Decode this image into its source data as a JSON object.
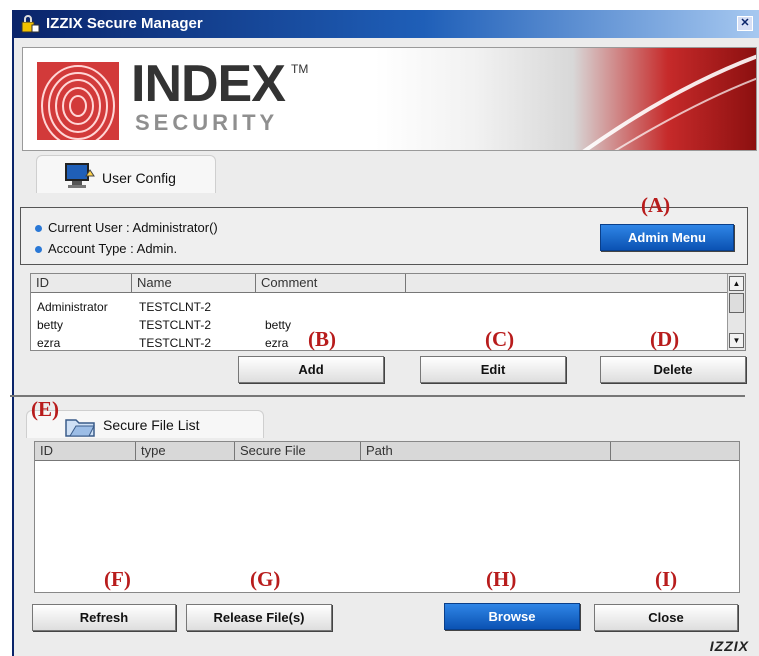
{
  "window": {
    "title": "IZZIX Secure Manager",
    "close_symbol": "✕"
  },
  "banner": {
    "brand_main": "INDEX",
    "brand_tm": "TM",
    "brand_sub": "SECURITY"
  },
  "user_config": {
    "tab_label": "User Config",
    "current_user": "Current User  : Administrator()",
    "account_type": "Account Type : Admin.",
    "admin_menu_label": "Admin Menu",
    "columns": [
      "ID",
      "Name",
      "Comment"
    ],
    "rows": [
      {
        "id": "Administrator",
        "name": "TESTCLNT-2",
        "comment": ""
      },
      {
        "id": "betty",
        "name": "TESTCLNT-2",
        "comment": "betty"
      },
      {
        "id": "ezra",
        "name": "TESTCLNT-2",
        "comment": "ezra"
      }
    ],
    "add_label": "Add",
    "edit_label": "Edit",
    "delete_label": "Delete"
  },
  "secure_file_list": {
    "tab_label": "Secure File List",
    "columns": [
      "ID",
      "type",
      "Secure File",
      "Path"
    ],
    "refresh_label": "Refresh",
    "release_label": "Release File(s)",
    "browse_label": "Browse",
    "close_label": "Close"
  },
  "annotations": {
    "a": "(A)",
    "b": "(B)",
    "c": "(C)",
    "d": "(D)",
    "e": "(E)",
    "f": "(F)",
    "g": "(G)",
    "h": "(H)",
    "i": "(I)"
  },
  "footer": {
    "logo": "IZZIX"
  },
  "colors": {
    "title_bar": "#0a246a",
    "accent_blue": "#0b52b3",
    "annotation_red": "#b81c1c",
    "banner_red": "#c62a2a"
  },
  "icons": [
    "padlock-app-icon",
    "fingerprint-logo-icon",
    "user-config-computer-icon",
    "secure-folder-icon",
    "close-icon"
  ]
}
